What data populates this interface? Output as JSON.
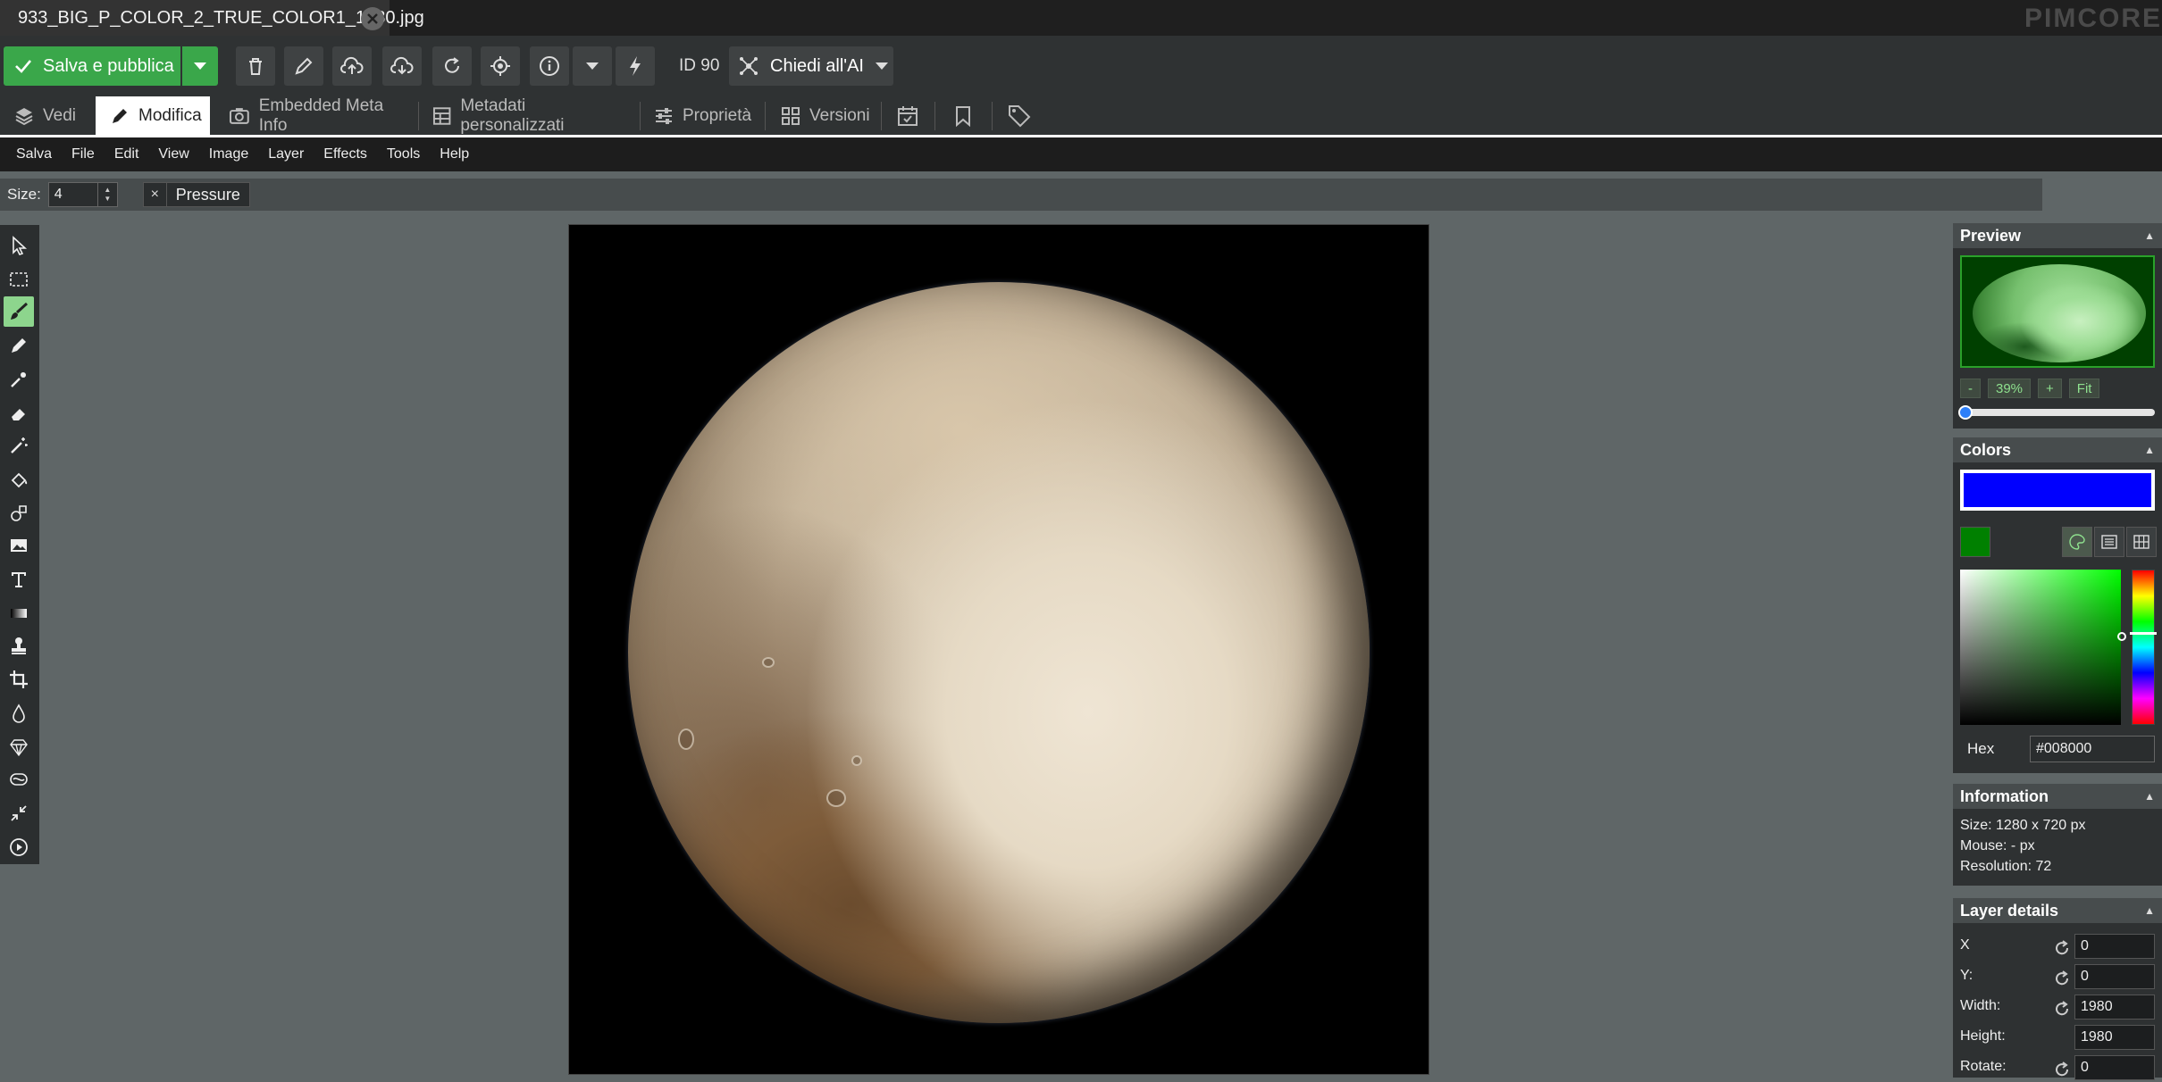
{
  "tab": {
    "title": "933_BIG_P_COLOR_2_TRUE_COLOR1_1980.jpg"
  },
  "brand": {
    "logo_text": "PIMCORE"
  },
  "toolbar": {
    "save_label": "Salva e pubblica",
    "id_label": "ID 90",
    "ai_label": "Chiedi all'AI"
  },
  "subtabs": [
    {
      "label": "Vedi"
    },
    {
      "label": "Modifica"
    },
    {
      "label": "Embedded Meta Info"
    },
    {
      "label": "Metadati personalizzati"
    },
    {
      "label": "Proprietà"
    },
    {
      "label": "Versioni"
    }
  ],
  "menu": [
    "Salva",
    "File",
    "Edit",
    "View",
    "Image",
    "Layer",
    "Effects",
    "Tools",
    "Help"
  ],
  "attributes": {
    "size_label": "Size:",
    "size_value": "4",
    "pressure_label": "Pressure"
  },
  "preview": {
    "title": "Preview",
    "zoom_minus": "-",
    "zoom_value": "39%",
    "zoom_plus": "+",
    "fit_label": "Fit"
  },
  "colors": {
    "title": "Colors",
    "primary": "#0000ff",
    "secondary": "#008000",
    "hex_label": "Hex",
    "hex_value": "#008000"
  },
  "information": {
    "title": "Information",
    "size": "Size: 1280 x 720 px",
    "mouse": "Mouse: - px",
    "resolution": "Resolution: 72"
  },
  "layer_details": {
    "title": "Layer details",
    "x_label": "X",
    "x_value": "0",
    "y_label": "Y:",
    "y_value": "0",
    "width_label": "Width:",
    "width_value": "1980",
    "height_label": "Height:",
    "height_value": "1980",
    "rotate_label": "Rotate:",
    "rotate_value": "0"
  },
  "tools": [
    "select-icon",
    "rect-select-icon",
    "brush-icon",
    "pencil-icon",
    "pipette-icon",
    "eraser-icon",
    "magic-wand-icon",
    "fill-icon",
    "shapes-icon",
    "image-icon",
    "text-icon",
    "gradient-icon",
    "clone-icon",
    "crop-icon",
    "blur-icon",
    "sharpen-icon",
    "bulge-icon",
    "resize-icon",
    "animation-icon"
  ]
}
